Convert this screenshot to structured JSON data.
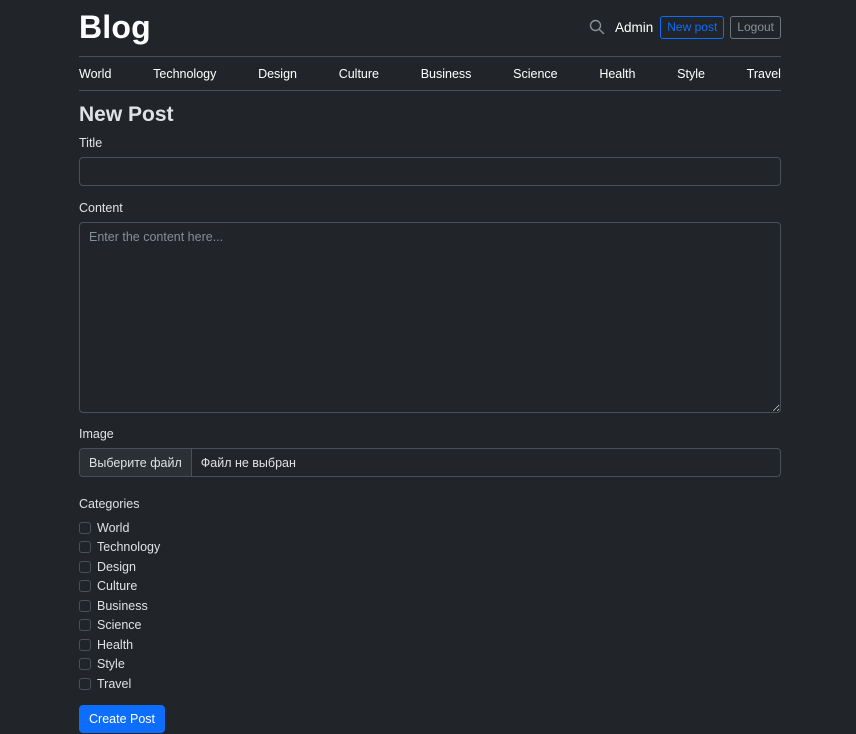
{
  "header": {
    "brand": "Blog",
    "search_icon": "search-icon",
    "user_link": "Admin",
    "new_post_label": "New post",
    "logout_label": "Logout"
  },
  "nav": {
    "items": [
      "World",
      "Technology",
      "Design",
      "Culture",
      "Business",
      "Science",
      "Health",
      "Style",
      "Travel"
    ]
  },
  "form": {
    "page_title": "New Post",
    "title_label": "Title",
    "title_value": "",
    "content_label": "Content",
    "content_placeholder": "Enter the content here...",
    "image_label": "Image",
    "file_button_label": "Выберите файл",
    "file_status": "Файл не выбран",
    "categories_label": "Categories",
    "categories": [
      {
        "label": "World",
        "checked": false
      },
      {
        "label": "Technology",
        "checked": false
      },
      {
        "label": "Design",
        "checked": false
      },
      {
        "label": "Culture",
        "checked": false
      },
      {
        "label": "Business",
        "checked": false
      },
      {
        "label": "Science",
        "checked": false
      },
      {
        "label": "Health",
        "checked": false
      },
      {
        "label": "Style",
        "checked": false
      },
      {
        "label": "Travel",
        "checked": false
      }
    ],
    "submit_label": "Create Post"
  },
  "colors": {
    "background": "#212529",
    "primary": "#0d6efd",
    "border": "#495057",
    "text": "#dee2e6"
  }
}
